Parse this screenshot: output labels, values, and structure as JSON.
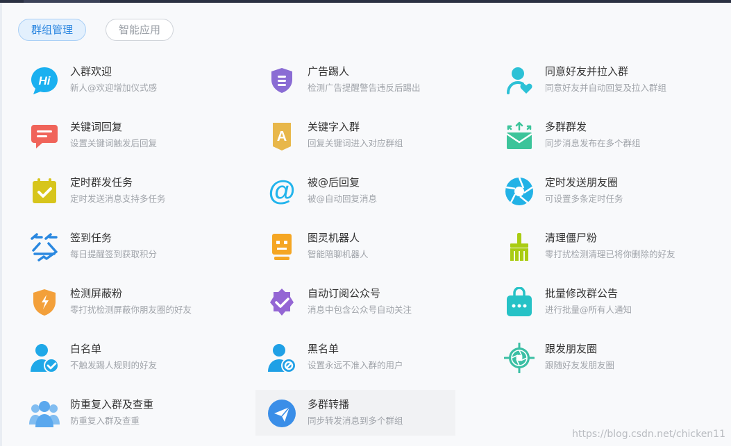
{
  "tabs": [
    {
      "label": "群组管理",
      "active": true
    },
    {
      "label": "智能应用",
      "active": false
    }
  ],
  "features": [
    {
      "title": "入群欢迎",
      "desc": "新人@欢迎增加仪式感",
      "icon": "hi-bubble-icon",
      "color": "#1ab0f0"
    },
    {
      "title": "广告踢人",
      "desc": "检测广告提醒警告违反后踢出",
      "icon": "shield-icon",
      "color": "#8a6cd4"
    },
    {
      "title": "同意好友并拉入群",
      "desc": "同意好友并自动回复及拉入群组",
      "icon": "user-heart-icon",
      "color": "#2cc1d6"
    },
    {
      "title": "关键词回复",
      "desc": "设置关键词触发后回复",
      "icon": "chat-reply-icon",
      "color": "#f0645a"
    },
    {
      "title": "关键字入群",
      "desc": "回复关键词进入对应群组",
      "icon": "letter-a-badge-icon",
      "color": "#e8b74a"
    },
    {
      "title": "多群群发",
      "desc": "同步消息发布在多个群组",
      "icon": "mail-broadcast-icon",
      "color": "#3cc49a"
    },
    {
      "title": "定时群发任务",
      "desc": "定时发送消息支持多任务",
      "icon": "calendar-check-icon",
      "color": "#d7c51c"
    },
    {
      "title": "被@后回复",
      "desc": "被@自动回复消息",
      "icon": "at-sign-icon",
      "color": "#22b4ec"
    },
    {
      "title": "定时发送朋友圈",
      "desc": "可设置多条定时任务",
      "icon": "aperture-icon",
      "color": "#22b2e6"
    },
    {
      "title": "签到任务",
      "desc": "每日提醒签到获取积分",
      "icon": "sign-in-icon",
      "color": "#2a88e0"
    },
    {
      "title": "图灵机器人",
      "desc": "智能陪聊机器人",
      "icon": "robot-icon",
      "color": "#f5a623"
    },
    {
      "title": "清理僵尸粉",
      "desc": "零打扰检测清理已将你删除的好友",
      "icon": "broom-icon",
      "color": "#a9cc12"
    },
    {
      "title": "检测屏蔽粉",
      "desc": "零打扰检测屏蔽你朋友圈的好友",
      "icon": "bolt-shield-icon",
      "color": "#f3a03a"
    },
    {
      "title": "自动订阅公众号",
      "desc": "消息中包含公众号自动关注",
      "icon": "verified-badge-icon",
      "color": "#9466d4"
    },
    {
      "title": "批量修改群公告",
      "desc": "进行批量@所有人通知",
      "icon": "notice-bag-icon",
      "color": "#26c2c6"
    },
    {
      "title": "白名单",
      "desc": "不触发踢人规则的好友",
      "icon": "user-check-icon",
      "color": "#1fa8e8"
    },
    {
      "title": "黑名单",
      "desc": "设置永远不准入群的用户",
      "icon": "user-block-icon",
      "color": "#1fa0e6"
    },
    {
      "title": "跟发朋友圈",
      "desc": "跟随好友发朋友圈",
      "icon": "target-aperture-icon",
      "color": "#3bbfa4"
    },
    {
      "title": "防重复入群及查重",
      "desc": "防重复入群及查重",
      "icon": "user-group-icon",
      "color": "#5aa8ee"
    },
    {
      "title": "多群转播",
      "desc": "同步转发消息到多个群组",
      "icon": "paper-plane-icon",
      "color": "#3a8ee8"
    }
  ],
  "watermark": "https://blog.csdn.net/chicken11"
}
